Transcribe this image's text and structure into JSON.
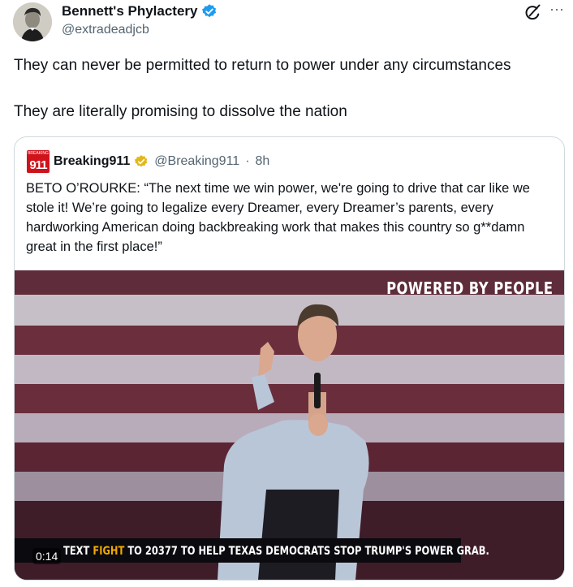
{
  "author": {
    "name": "Bennett's Phylactery",
    "handle": "@extradeadjcb",
    "verified": true,
    "verified_color": "#1d9bf0"
  },
  "actions": {
    "grok_icon": "grok-icon",
    "more_label": "···"
  },
  "tweet": {
    "paragraphs": [
      "They can never be permitted to return to power under any circumstances",
      "They are literally promising to dissolve the nation"
    ]
  },
  "quote": {
    "logo_top": "BREAKING",
    "logo_num": "911",
    "name": "Breaking911",
    "verified_color": "#e2b719",
    "handle": "@Breaking911",
    "separator": "·",
    "time": "8h",
    "text": "BETO O’ROURKE: “The next time we win power, we're going to drive that car like we stole it! We’re going to legalize every Dreamer, every Dreamer’s parents, every hardworking American doing backbreaking work that makes this country so g**damn great in the first place!”"
  },
  "video": {
    "watermark": "POWERED BY PEOPLE",
    "banner_prefix": "TEXT",
    "banner_highlight": "FIGHT",
    "banner_rest": "TO 20377 TO HELP TEXAS DEMOCRATS STOP TRUMP'S POWER GRAB.",
    "timestamp": "0:14"
  }
}
